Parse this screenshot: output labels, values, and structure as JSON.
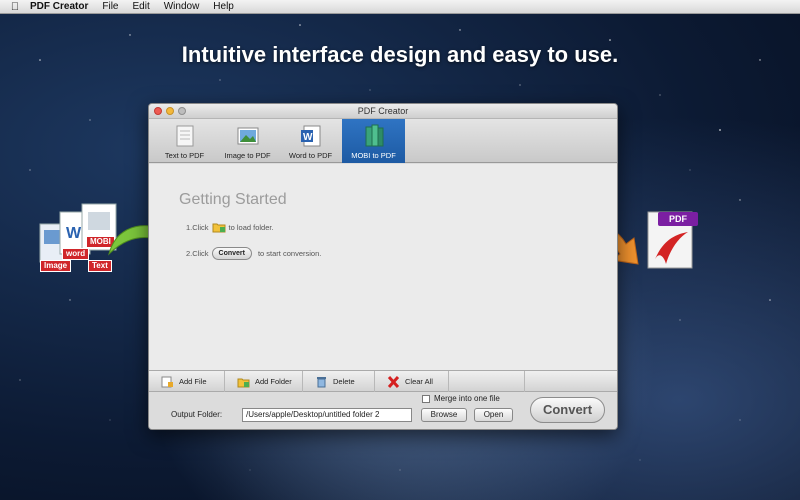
{
  "menubar": {
    "app_name": "PDF Creator",
    "items": [
      "File",
      "Edit",
      "Window",
      "Help"
    ]
  },
  "headline": "Intuitive interface design and easy to use.",
  "window": {
    "title": "PDF Creator",
    "tabs": [
      {
        "label": "Text to PDF",
        "icon": "text-doc-icon",
        "active": false
      },
      {
        "label": "Image to PDF",
        "icon": "image-icon",
        "active": false
      },
      {
        "label": "Word to PDF",
        "icon": "word-icon",
        "active": false
      },
      {
        "label": "MOBI to PDF",
        "icon": "books-icon",
        "active": true
      }
    ],
    "getting_started": {
      "title": "Getting Started",
      "step1_prefix": "1.Click",
      "step1_suffix": "to load folder.",
      "step2_prefix": "2.Click",
      "step2_button": "Convert",
      "step2_suffix": "to start conversion."
    },
    "actions": [
      {
        "label": "Add File",
        "icon": "add-file-icon"
      },
      {
        "label": "Add Folder",
        "icon": "add-folder-icon"
      },
      {
        "label": "Delete",
        "icon": "trash-icon"
      },
      {
        "label": "Clear All",
        "icon": "red-x-icon"
      }
    ],
    "output": {
      "label": "Output Folder:",
      "path": "/Users/apple/Desktop/untitled folder 2",
      "merge_label": "Merge into one file",
      "merge_checked": false,
      "browse": "Browse",
      "open": "Open",
      "convert": "Convert"
    }
  },
  "decor": {
    "doc_labels": [
      "MOBI",
      "word",
      "Image",
      "Text"
    ],
    "pdf_badge": "PDF"
  },
  "colors": {
    "active_tab": "#2f74c3",
    "label_red": "#d0262a",
    "pdf_purple": "#7b1fa2"
  }
}
